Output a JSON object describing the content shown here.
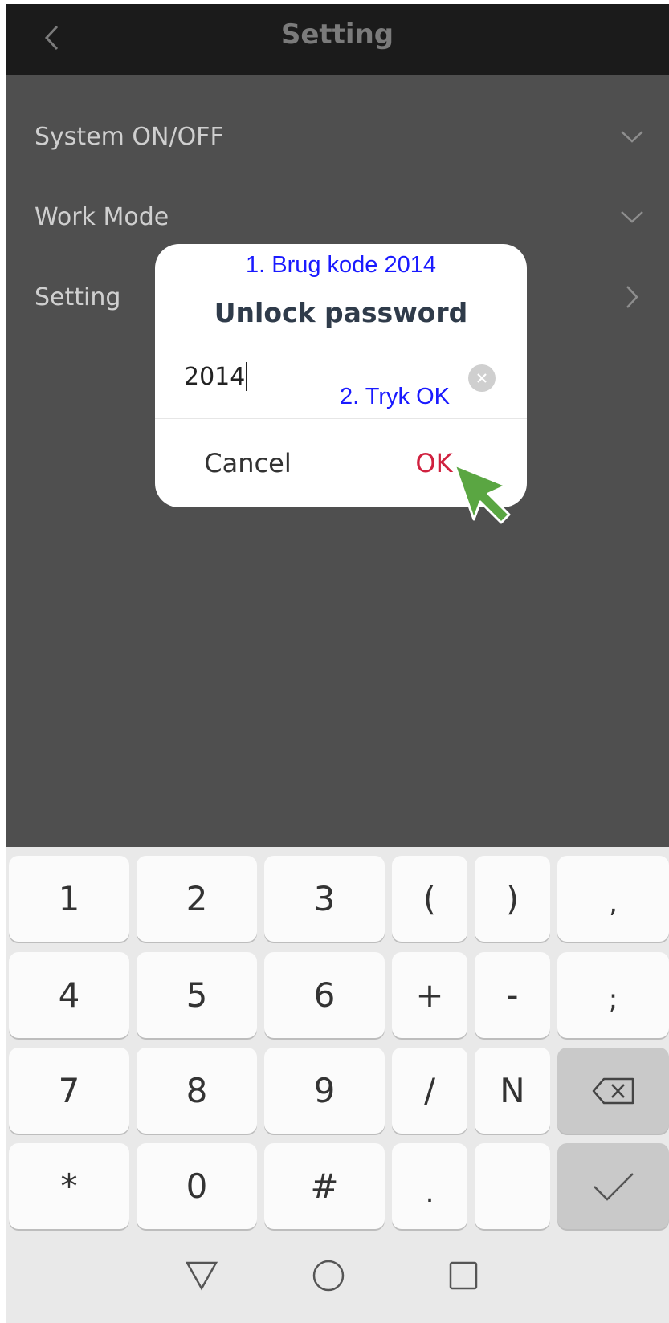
{
  "header": {
    "title": "Setting"
  },
  "list": [
    {
      "label": "System ON/OFF",
      "icon": "chevron-down-icon"
    },
    {
      "label": "Work Mode",
      "icon": "chevron-down-icon"
    },
    {
      "label": "Setting",
      "icon": "chevron-right-icon"
    }
  ],
  "dialog": {
    "annotation_1": "1. Brug kode 2014",
    "title": "Unlock password",
    "input_value": "2014",
    "annotation_2": "2. Tryk OK",
    "cancel_label": "Cancel",
    "ok_label": "OK"
  },
  "keyboard": {
    "keys": [
      {
        "label": "1"
      },
      {
        "label": "2"
      },
      {
        "label": "3"
      },
      {
        "label": "("
      },
      {
        "label": ")"
      },
      {
        "label": ","
      },
      {
        "label": "4"
      },
      {
        "label": "5"
      },
      {
        "label": "6"
      },
      {
        "label": "+"
      },
      {
        "label": "-"
      },
      {
        "label": ";"
      },
      {
        "label": "7"
      },
      {
        "label": "8"
      },
      {
        "label": "9"
      },
      {
        "label": "/"
      },
      {
        "label": "N"
      },
      {
        "label": ""
      },
      {
        "label": "*"
      },
      {
        "label": "0"
      },
      {
        "label": "#"
      },
      {
        "label": "."
      },
      {
        "label": ""
      },
      {
        "label": ""
      }
    ]
  },
  "colors": {
    "ok_text": "#d0213f",
    "annotation_text": "#1a1aff",
    "pointer": "#5aa642"
  }
}
